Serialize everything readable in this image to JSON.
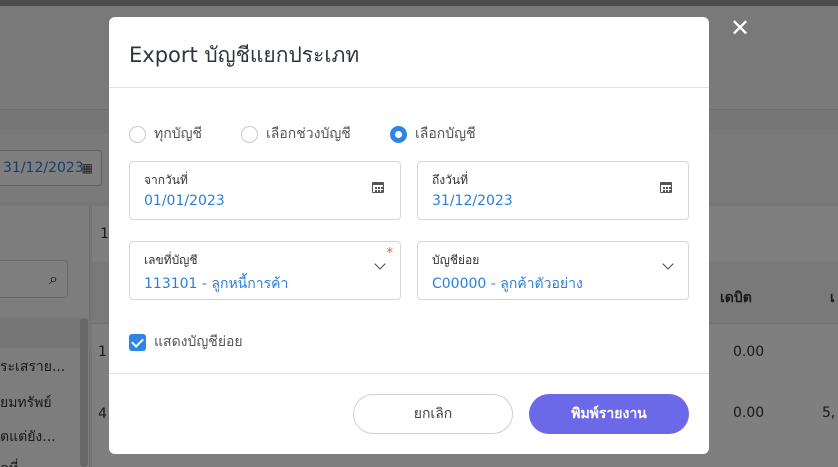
{
  "background": {
    "date_value": "31/12/2023",
    "table_first_col": "1",
    "col_debit": "เดบิต",
    "col_extra": "เ",
    "cell_debit_1": "0.00",
    "cell_debit_2": "0.00",
    "cell_extra_2": "5,",
    "left_items": [
      "ระเสราย...",
      "ยมทรัพย์",
      "ตแต่ยัง...",
      "ดที่"
    ],
    "row_mark_1": "1",
    "row_mark_2": "4"
  },
  "modal": {
    "title": "Export บัญชีแยกประเภท",
    "radios": [
      {
        "label": "ทุกบัญชี",
        "checked": false
      },
      {
        "label": "เลือกช่วงบัญชี",
        "checked": false
      },
      {
        "label": "เลือกบัญชี",
        "checked": true
      }
    ],
    "from_date": {
      "label": "จากวันที่",
      "value": "01/01/2023"
    },
    "to_date": {
      "label": "ถึงวันที่",
      "value": "31/12/2023"
    },
    "account": {
      "label": "เลขที่บัญชี",
      "value": "113101 - ลูกหนี้การค้า",
      "required_mark": "*"
    },
    "sub_account": {
      "label": "บัญชีย่อย",
      "value": "C00000 - ลูกค้าตัวอย่าง"
    },
    "show_sub": {
      "label": "แสดงบัญชีย่อย",
      "checked": true
    },
    "cancel_label": "ยกเลิก",
    "print_label": "พิมพ์รายงาน",
    "close_glyph": "✕"
  },
  "colors": {
    "accent_blue": "#2c86e8",
    "primary_button": "#6c69e8",
    "value_text": "#2c7fd6",
    "required": "#e05a2b"
  },
  "icons": [
    "calendar-icon",
    "chevron-down-icon",
    "search-icon",
    "close-icon",
    "checkmark-icon"
  ]
}
